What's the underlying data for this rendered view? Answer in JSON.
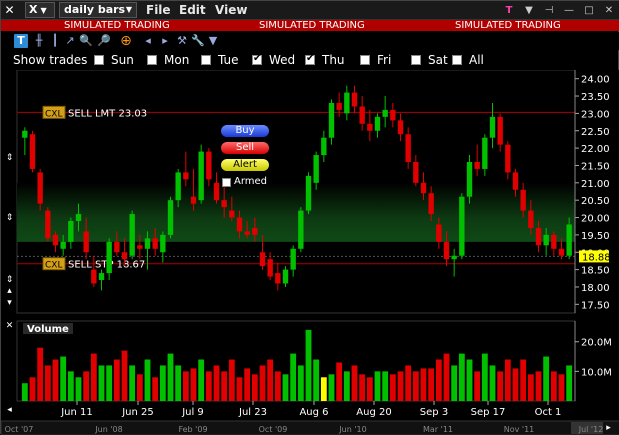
{
  "window": {
    "symbol": "X",
    "period": "daily bars",
    "menus": [
      "File",
      "Edit",
      "View"
    ]
  },
  "banner": {
    "text": "SIMULATED TRADING"
  },
  "show_trades": {
    "label": "Show trades",
    "days": [
      {
        "label": "Sun",
        "checked": false
      },
      {
        "label": "Mon",
        "checked": false
      },
      {
        "label": "Tue",
        "checked": false
      },
      {
        "label": "Wed",
        "checked": true
      },
      {
        "label": "Thu",
        "checked": true
      },
      {
        "label": "Fri",
        "checked": false
      },
      {
        "label": "Sat",
        "checked": false
      },
      {
        "label": "All",
        "checked": false
      }
    ]
  },
  "orders": {
    "sell_limit_tag": "CXL",
    "sell_limit_label": "SELL LMT 23.03",
    "sell_stop_tag": "CXL",
    "sell_stop_label": "SELL STP 18.67",
    "buy_label": "Buy",
    "sell_label": "Sell",
    "alert_label": "Alert",
    "armed_label": "Armed"
  },
  "price_axis": {
    "ticks": [
      "24.00",
      "23.50",
      "23.00",
      "22.50",
      "22.00",
      "21.50",
      "21.00",
      "20.50",
      "20.00",
      "19.50",
      "19.00",
      "18.50",
      "18.00",
      "17.50"
    ],
    "last_price": "18.88"
  },
  "volume_panel": {
    "title": "Volume",
    "ticks": [
      "20.0M",
      "10.0M"
    ]
  },
  "date_axis": {
    "labels": [
      "Jun 11",
      "Jun 25",
      "Jul 9",
      "Jul 23",
      "Aug 6",
      "Aug 20",
      "Sep 3",
      "Sep 17",
      "Oct 1"
    ]
  },
  "overview_axis": {
    "labels": [
      "Oct '07",
      "Jun '08",
      "Feb '09",
      "Oct '09",
      "Jun '10",
      "Mar '11",
      "Nov '11",
      "Jul '12"
    ]
  },
  "colors": {
    "up": "#00c000",
    "down": "#e00000",
    "highlight_volume": "#ffff00",
    "order_line": "#b00000",
    "band": "#0a3a0a"
  },
  "chart_data": {
    "type": "candlestick",
    "ylim": [
      17.25,
      24.25
    ],
    "candles": [
      {
        "o": 22.3,
        "h": 22.6,
        "l": 21.8,
        "c": 22.5
      },
      {
        "o": 22.4,
        "h": 22.5,
        "l": 21.3,
        "c": 21.4
      },
      {
        "o": 21.3,
        "h": 21.4,
        "l": 20.2,
        "c": 20.4
      },
      {
        "o": 20.2,
        "h": 20.3,
        "l": 19.3,
        "c": 19.4
      },
      {
        "o": 19.5,
        "h": 19.6,
        "l": 19.0,
        "c": 19.2
      },
      {
        "o": 19.1,
        "h": 19.5,
        "l": 18.9,
        "c": 19.3
      },
      {
        "o": 19.3,
        "h": 20.0,
        "l": 19.1,
        "c": 19.9
      },
      {
        "o": 19.9,
        "h": 20.4,
        "l": 19.6,
        "c": 20.1
      },
      {
        "o": 19.6,
        "h": 20.0,
        "l": 18.8,
        "c": 19.0
      },
      {
        "o": 18.5,
        "h": 18.9,
        "l": 18.0,
        "c": 18.1
      },
      {
        "o": 18.2,
        "h": 18.5,
        "l": 17.9,
        "c": 18.4
      },
      {
        "o": 18.4,
        "h": 19.4,
        "l": 18.2,
        "c": 19.3
      },
      {
        "o": 19.3,
        "h": 19.6,
        "l": 18.9,
        "c": 19.0
      },
      {
        "o": 19.0,
        "h": 19.4,
        "l": 18.6,
        "c": 18.8
      },
      {
        "o": 18.9,
        "h": 20.2,
        "l": 18.8,
        "c": 20.1
      },
      {
        "o": 19.2,
        "h": 19.5,
        "l": 18.8,
        "c": 19.1
      },
      {
        "o": 19.1,
        "h": 19.6,
        "l": 18.5,
        "c": 19.4
      },
      {
        "o": 19.4,
        "h": 19.7,
        "l": 18.9,
        "c": 19.1
      },
      {
        "o": 19.0,
        "h": 19.6,
        "l": 18.7,
        "c": 19.5
      },
      {
        "o": 19.5,
        "h": 20.6,
        "l": 19.4,
        "c": 20.5
      },
      {
        "o": 20.5,
        "h": 21.4,
        "l": 20.3,
        "c": 21.3
      },
      {
        "o": 21.3,
        "h": 21.9,
        "l": 20.9,
        "c": 21.1
      },
      {
        "o": 20.6,
        "h": 21.4,
        "l": 20.2,
        "c": 20.4
      },
      {
        "o": 20.5,
        "h": 22.1,
        "l": 20.4,
        "c": 21.9
      },
      {
        "o": 21.9,
        "h": 22.0,
        "l": 20.9,
        "c": 21.1
      },
      {
        "o": 21.0,
        "h": 21.3,
        "l": 20.4,
        "c": 20.5
      },
      {
        "o": 20.5,
        "h": 20.9,
        "l": 20.0,
        "c": 20.3
      },
      {
        "o": 20.2,
        "h": 20.6,
        "l": 19.9,
        "c": 20.0
      },
      {
        "o": 20.0,
        "h": 20.2,
        "l": 19.4,
        "c": 19.6
      },
      {
        "o": 19.6,
        "h": 19.9,
        "l": 19.4,
        "c": 19.5
      },
      {
        "o": 19.7,
        "h": 20.0,
        "l": 19.3,
        "c": 19.5
      },
      {
        "o": 19.0,
        "h": 19.5,
        "l": 18.5,
        "c": 18.6
      },
      {
        "o": 18.8,
        "h": 19.0,
        "l": 18.2,
        "c": 18.3
      },
      {
        "o": 18.4,
        "h": 18.7,
        "l": 17.9,
        "c": 18.1
      },
      {
        "o": 18.1,
        "h": 18.6,
        "l": 18.0,
        "c": 18.5
      },
      {
        "o": 18.5,
        "h": 19.2,
        "l": 18.3,
        "c": 19.1
      },
      {
        "o": 19.1,
        "h": 20.3,
        "l": 19.0,
        "c": 20.2
      },
      {
        "o": 20.2,
        "h": 21.3,
        "l": 20.1,
        "c": 21.2
      },
      {
        "o": 21.0,
        "h": 21.9,
        "l": 20.8,
        "c": 21.8
      },
      {
        "o": 21.8,
        "h": 22.5,
        "l": 21.6,
        "c": 22.3
      },
      {
        "o": 22.3,
        "h": 23.4,
        "l": 22.1,
        "c": 23.3
      },
      {
        "o": 23.3,
        "h": 23.6,
        "l": 22.9,
        "c": 23.1
      },
      {
        "o": 23.0,
        "h": 23.8,
        "l": 22.8,
        "c": 23.6
      },
      {
        "o": 23.6,
        "h": 23.8,
        "l": 23.0,
        "c": 23.2
      },
      {
        "o": 23.2,
        "h": 23.5,
        "l": 22.5,
        "c": 22.7
      },
      {
        "o": 22.7,
        "h": 23.1,
        "l": 22.2,
        "c": 22.5
      },
      {
        "o": 22.5,
        "h": 23.0,
        "l": 22.3,
        "c": 22.9
      },
      {
        "o": 22.9,
        "h": 23.5,
        "l": 22.6,
        "c": 23.1
      },
      {
        "o": 23.1,
        "h": 23.3,
        "l": 22.6,
        "c": 22.8
      },
      {
        "o": 22.8,
        "h": 23.0,
        "l": 22.2,
        "c": 22.4
      },
      {
        "o": 22.4,
        "h": 22.6,
        "l": 21.4,
        "c": 21.6
      },
      {
        "o": 21.6,
        "h": 21.8,
        "l": 20.9,
        "c": 21.0
      },
      {
        "o": 21.0,
        "h": 21.3,
        "l": 20.5,
        "c": 20.7
      },
      {
        "o": 20.7,
        "h": 20.9,
        "l": 19.9,
        "c": 20.1
      },
      {
        "o": 19.8,
        "h": 20.0,
        "l": 19.1,
        "c": 19.3
      },
      {
        "o": 19.3,
        "h": 19.6,
        "l": 18.6,
        "c": 18.8
      },
      {
        "o": 18.8,
        "h": 19.1,
        "l": 18.3,
        "c": 18.9
      },
      {
        "o": 18.9,
        "h": 20.7,
        "l": 18.8,
        "c": 20.6
      },
      {
        "o": 20.6,
        "h": 21.8,
        "l": 20.4,
        "c": 21.6
      },
      {
        "o": 21.6,
        "h": 22.1,
        "l": 21.2,
        "c": 21.4
      },
      {
        "o": 21.4,
        "h": 22.4,
        "l": 21.2,
        "c": 22.3
      },
      {
        "o": 22.3,
        "h": 23.3,
        "l": 22.0,
        "c": 22.9
      },
      {
        "o": 22.9,
        "h": 23.0,
        "l": 21.9,
        "c": 22.1
      },
      {
        "o": 22.1,
        "h": 22.2,
        "l": 21.1,
        "c": 21.3
      },
      {
        "o": 21.3,
        "h": 21.4,
        "l": 20.6,
        "c": 20.8
      },
      {
        "o": 20.8,
        "h": 21.0,
        "l": 20.0,
        "c": 20.2
      },
      {
        "o": 20.2,
        "h": 20.5,
        "l": 19.5,
        "c": 19.7
      },
      {
        "o": 19.7,
        "h": 19.9,
        "l": 19.0,
        "c": 19.2
      },
      {
        "o": 19.2,
        "h": 19.7,
        "l": 18.9,
        "c": 19.5
      },
      {
        "o": 19.5,
        "h": 19.6,
        "l": 18.9,
        "c": 19.1
      },
      {
        "o": 19.1,
        "h": 19.4,
        "l": 18.8,
        "c": 18.9
      },
      {
        "o": 18.9,
        "h": 20.0,
        "l": 18.8,
        "c": 19.8
      }
    ],
    "volume_m": [
      6,
      8,
      18,
      12,
      14,
      15,
      10,
      8,
      10,
      16,
      12,
      12,
      14,
      17,
      12,
      9,
      14,
      8,
      12,
      16,
      12,
      10,
      11,
      14,
      10,
      12,
      10,
      14,
      8,
      11,
      9,
      12,
      14,
      10,
      9,
      16,
      12,
      24,
      14,
      8,
      9,
      13,
      10,
      12,
      9,
      8,
      10,
      10,
      9,
      10,
      12,
      10,
      11,
      11,
      14,
      16,
      12,
      16,
      14,
      10,
      16,
      12,
      10,
      14,
      11,
      14,
      9,
      10,
      15,
      10,
      9,
      12
    ],
    "highlight_index": 39,
    "sell_limit": 23.03,
    "sell_stop": 18.67,
    "last": 18.88,
    "x_labels": [
      "Jun 11",
      "Jun 25",
      "Jul 9",
      "Jul 23",
      "Aug 6",
      "Aug 20",
      "Sep 3",
      "Sep 17",
      "Oct 1"
    ],
    "volume_ticks_m": [
      20,
      10
    ]
  }
}
